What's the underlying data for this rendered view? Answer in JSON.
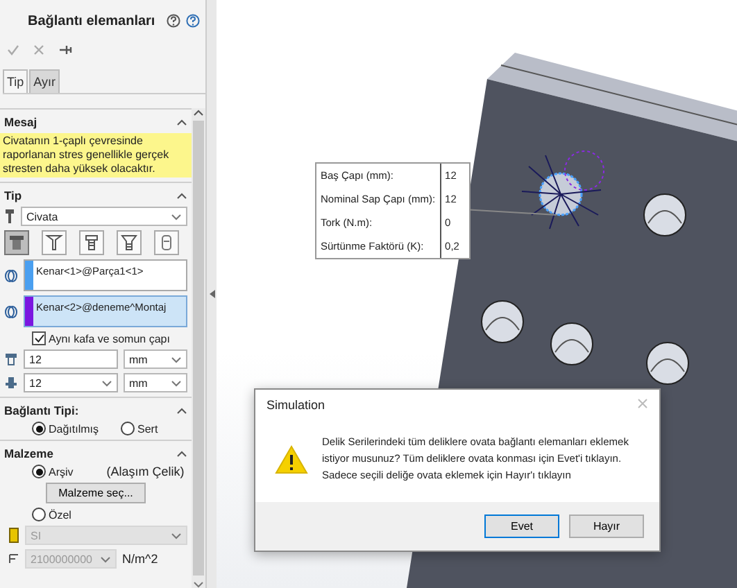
{
  "panel": {
    "title": "Bağlantı elemanları",
    "tabs": [
      {
        "label": "Tip",
        "selected": true
      },
      {
        "label": "Ayır",
        "selected": false
      }
    ],
    "message": {
      "heading": "Mesaj",
      "text": "Civatanın 1-çaplı çevresinde raporlanan stres genellikle gerçek stresten daha yüksek olacaktır."
    },
    "type_section": {
      "heading": "Tip",
      "connector": "Civata",
      "connector_types": [
        {
          "selected": true
        },
        {
          "selected": false
        },
        {
          "selected": false
        },
        {
          "selected": false
        },
        {
          "selected": false
        }
      ],
      "selections": [
        {
          "value": "Kenar<1>@Parça1<1>",
          "color": "#4a9ff0",
          "selected": false
        },
        {
          "value": "Kenar<2>@deneme^Montaj",
          "color": "#7b16e0",
          "selected": true
        }
      ],
      "same_diameter": {
        "label": "Aynı kafa ve somun çapı",
        "checked": true
      },
      "head_diameter": {
        "value": "12",
        "unit": "mm"
      },
      "nut_diameter": {
        "value": "12",
        "unit": "mm"
      }
    },
    "connection_type": {
      "heading": "Bağlantı Tipi:",
      "options": [
        {
          "label": "Dağıtılmış",
          "selected": true
        },
        {
          "label": "Sert",
          "selected": false
        }
      ]
    },
    "material": {
      "heading": "Malzeme",
      "options": [
        {
          "label": "Arşiv",
          "selected": true,
          "note": "(Alaşım Çelik)"
        },
        {
          "label": "Özel",
          "selected": false
        }
      ],
      "button": "Malzeme seç...",
      "units": "SI",
      "modulus": {
        "value": "2100000000",
        "unit": "N/m^2"
      }
    }
  },
  "callout": {
    "rows": [
      {
        "label": "Baş Çapı (mm):",
        "value": "12"
      },
      {
        "label": "Nominal Sap Çapı (mm):",
        "value": "12"
      },
      {
        "label": "Tork (N.m):",
        "value": "0"
      },
      {
        "label": "Sürtünme Faktörü (K):",
        "value": "0,2"
      }
    ]
  },
  "dialog": {
    "title": "Simulation",
    "message": "Delik Serilerindeki tüm deliklere ovata bağlantı elemanları eklemek istiyor musunuz? Tüm deliklere ovata konması için Evet'i tıklayın. Sadece seçili deliğe ovata eklemek için Hayır'ı tıklayın",
    "buttons": [
      {
        "label": "Evet",
        "selected": true
      },
      {
        "label": "Hayır",
        "selected": false
      }
    ]
  }
}
